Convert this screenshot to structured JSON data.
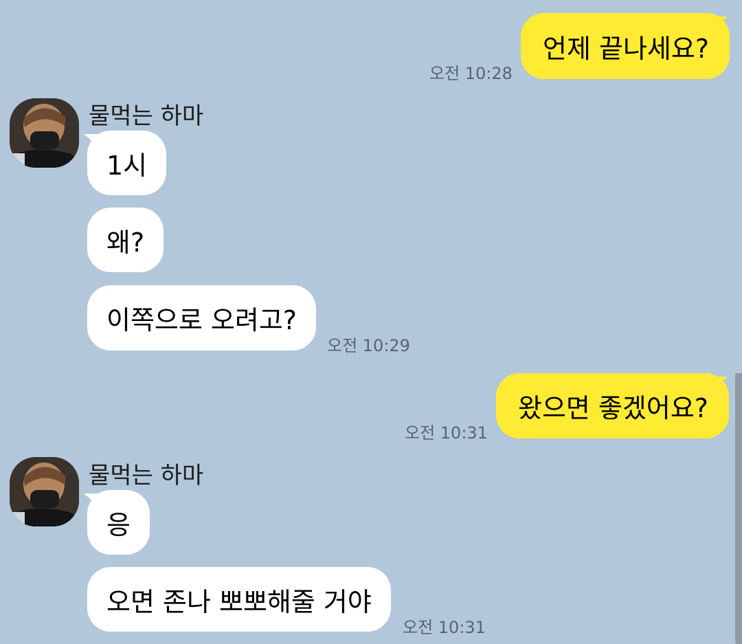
{
  "conversation": {
    "messages": [
      {
        "direction": "out",
        "text": "언제 끝나세요?",
        "time": "오전 10:28"
      },
      {
        "direction": "in",
        "sender": "물먹는 하마",
        "texts": [
          "1시",
          "왜?",
          "이쪽으로 오려고?"
        ],
        "time": "오전 10:29"
      },
      {
        "direction": "out",
        "text": "왔으면 좋겠어요?",
        "time": "오전 10:31"
      },
      {
        "direction": "in",
        "sender": "물먹는 하마",
        "texts": [
          "응",
          "오면 존나 뽀뽀해줄 거야"
        ],
        "time": "오전 10:31"
      }
    ]
  },
  "icons": {
    "avatar": "profile-photo-icon"
  },
  "colors": {
    "background": "#b2c7da",
    "outgoing_bubble": "#ffeb33",
    "incoming_bubble": "#ffffff",
    "timestamp": "#5a6470"
  }
}
